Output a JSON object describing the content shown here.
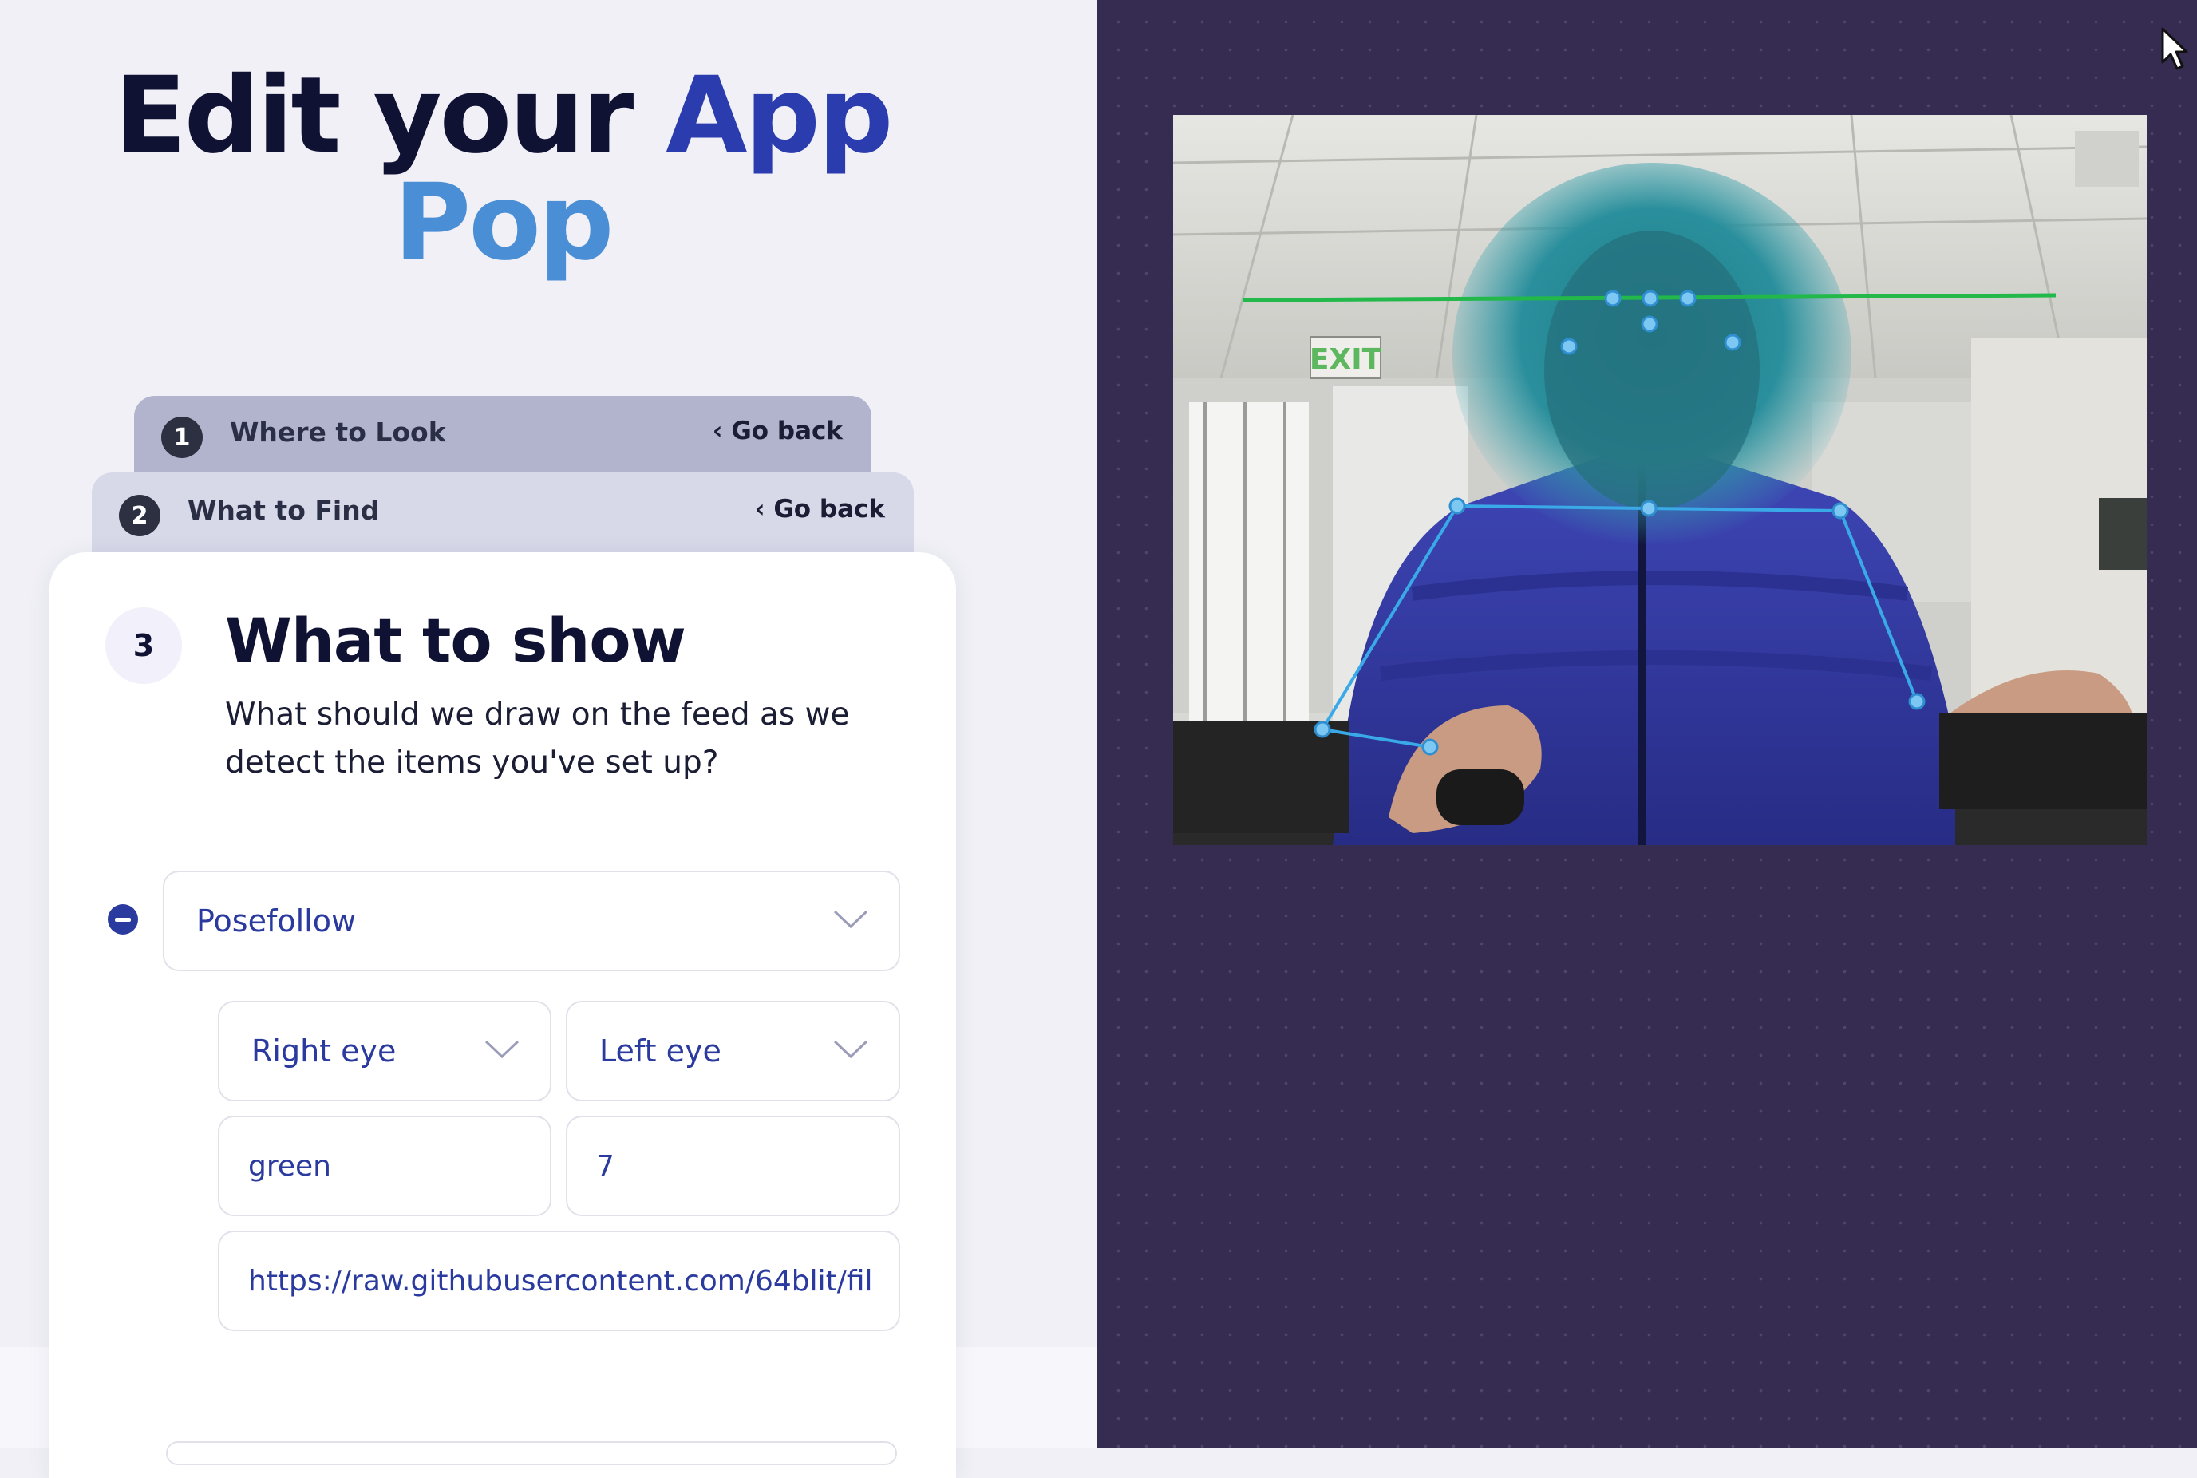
{
  "header": {
    "title_part1": "Edit your",
    "title_part2": "App",
    "title_part3": "Pop"
  },
  "steps": [
    {
      "number": "1",
      "label": "Where to Look",
      "go_back": "‹ Go back"
    },
    {
      "number": "2",
      "label": "What to Find",
      "go_back": "‹ Go back"
    }
  ],
  "current_step": {
    "number": "3",
    "title": "What to show",
    "description": "What should we draw on the feed as we detect the items you've set up?"
  },
  "form": {
    "effect_select": "Posefollow",
    "from_point_select": "Right eye",
    "to_point_select": "Left eye",
    "color_input": "green",
    "thickness_input": "7",
    "image_url_input": "https://raw.githubusercontent.com/64blit/fil"
  },
  "colors": {
    "accent": "#2a3cae",
    "accent_light": "#4a8ed6",
    "title_dark": "#101234",
    "right_panel_bg": "#362c52",
    "pose_line": "#3aa9e8",
    "overlay_line": "#22b84a"
  },
  "icons": {
    "remove": "minus-circle-icon",
    "dropdown": "chevron-down-icon",
    "cursor": "mouse-pointer-icon"
  },
  "video": {
    "sign_text": "EXIT"
  }
}
